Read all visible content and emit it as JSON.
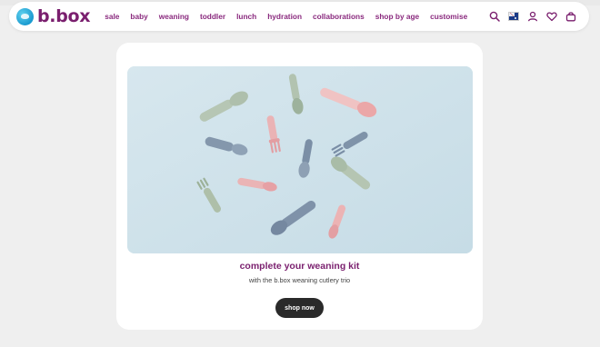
{
  "brand": {
    "name": "b.box"
  },
  "nav": {
    "items": [
      {
        "label": "sale"
      },
      {
        "label": "baby"
      },
      {
        "label": "weaning"
      },
      {
        "label": "toddler"
      },
      {
        "label": "lunch"
      },
      {
        "label": "hydration"
      },
      {
        "label": "collaborations"
      },
      {
        "label": "shop by age"
      },
      {
        "label": "customise"
      }
    ]
  },
  "header_icons": [
    "search-icon",
    "australia-flag-icon",
    "account-icon",
    "wishlist-heart-icon",
    "cart-bag-icon"
  ],
  "promo": {
    "headline": "complete your weaning kit",
    "subline": "with the b.box weaning cutlery trio",
    "cta_label": "shop now",
    "image": "weaning-cutlery-flatlay"
  },
  "colors": {
    "brand_purple": "#7a1f6e",
    "nav_purple": "#8a2a7e",
    "cta_bg": "#2a2a2a",
    "hero_bg": "#cfe2ea",
    "page_bg": "#efefef"
  }
}
